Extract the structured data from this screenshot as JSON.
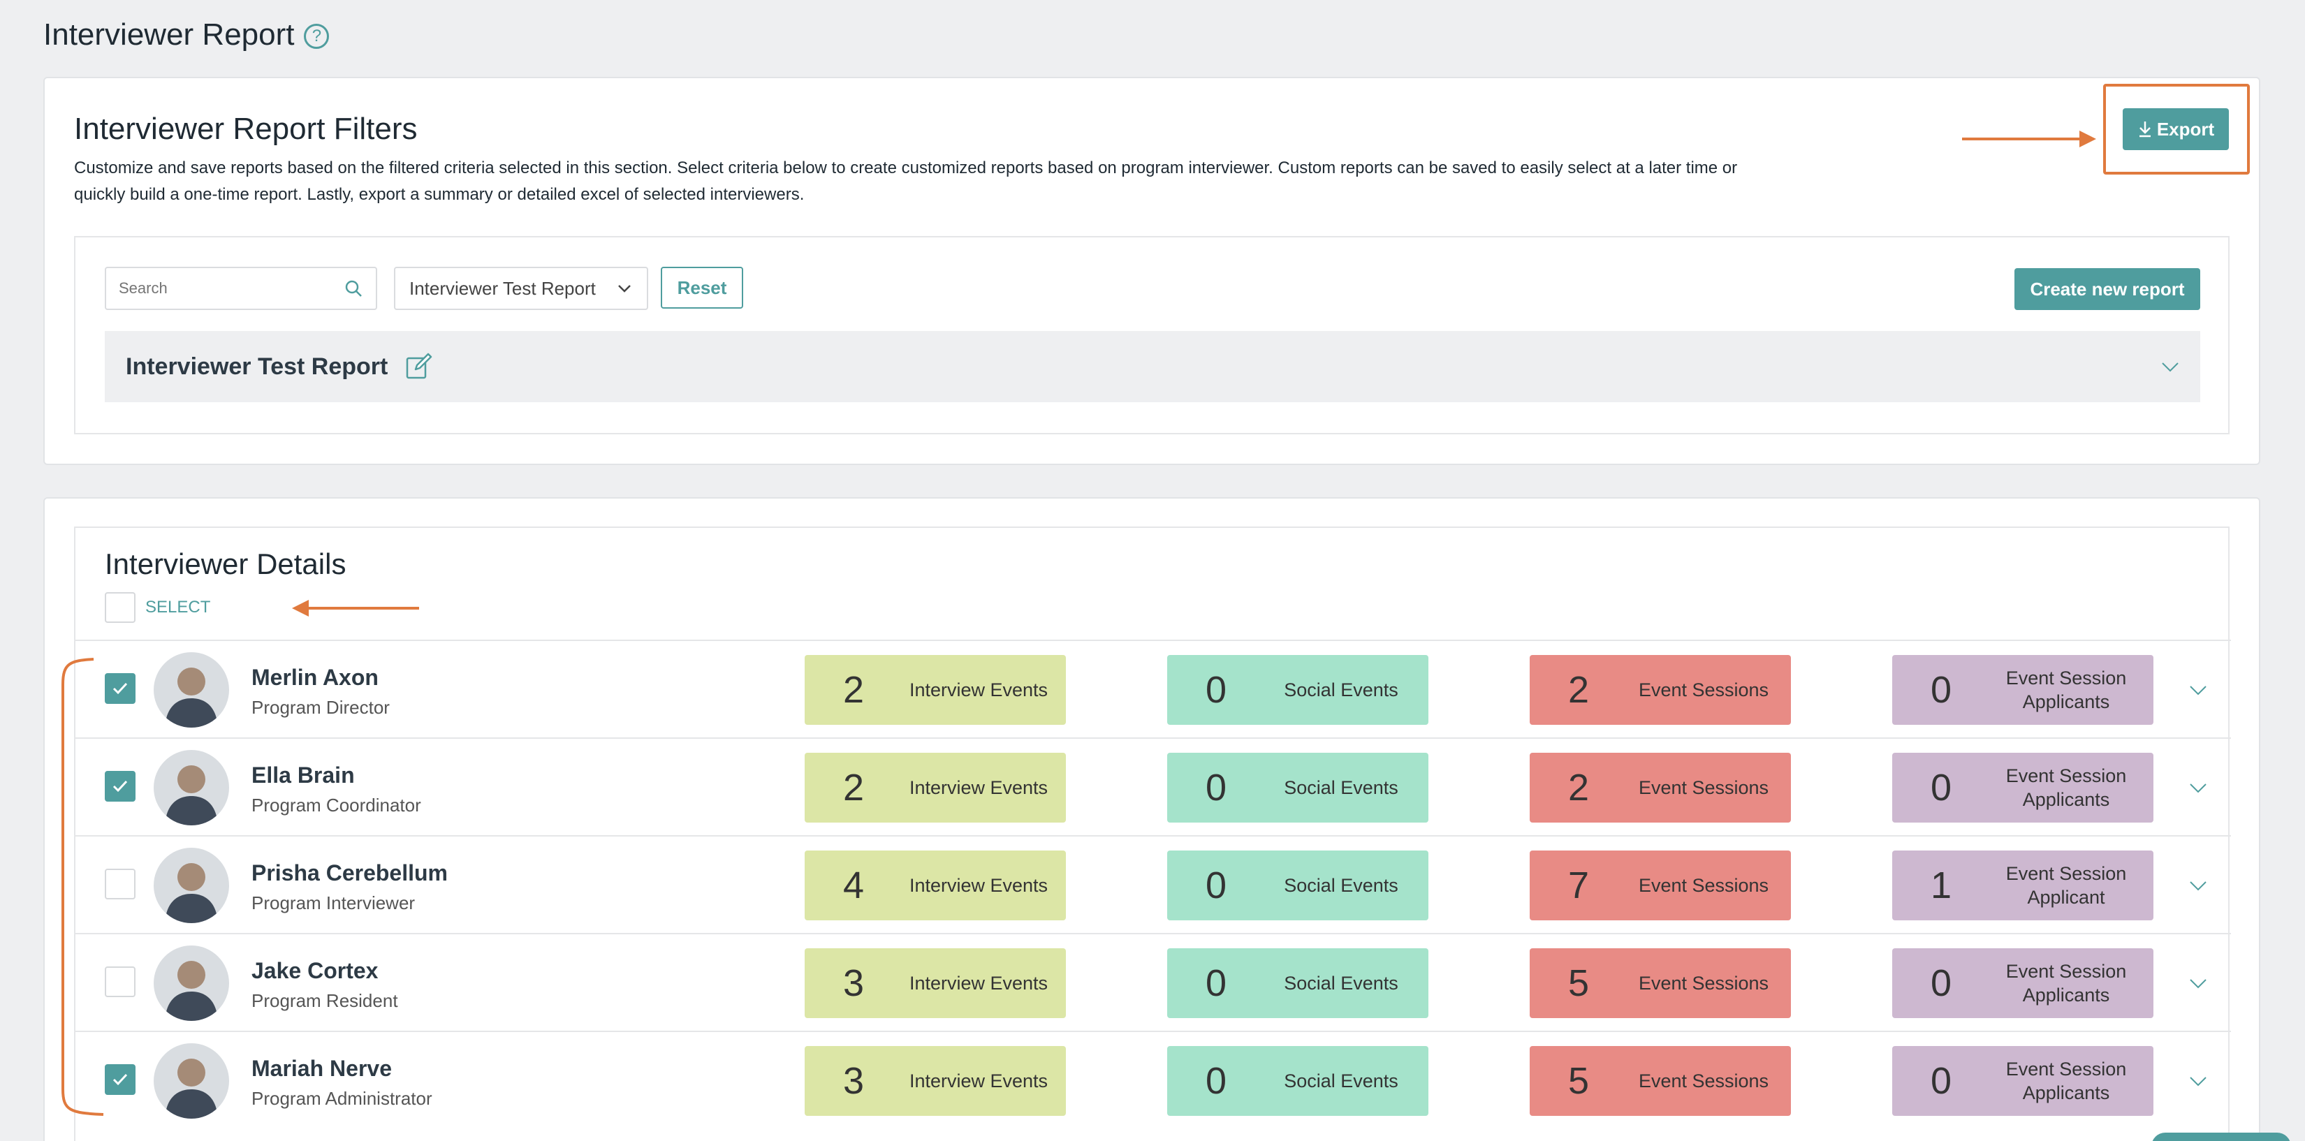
{
  "page": {
    "title": "Interviewer Report"
  },
  "filters": {
    "title": "Interviewer Report Filters",
    "description": "Customize and save reports based on the filtered criteria selected in this section. Select criteria below to create customized reports based on program interviewer. Custom reports can be saved to easily select at a later time or quickly build a one-time report. Lastly, export a summary or detailed excel of selected interviewers.",
    "export_label": "Export",
    "search_placeholder": "Search",
    "selected_report": "Interviewer Test Report",
    "reset_label": "Reset",
    "create_label": "Create new report",
    "report_panel_title": "Interviewer Test Report"
  },
  "details": {
    "title": "Interviewer Details",
    "select_label": "SELECT",
    "rows": [
      {
        "name": "Merlin Axon",
        "role": "Program Director",
        "checked": true,
        "interview_count": "2",
        "interview_label": "Interview Events",
        "social_count": "0",
        "social_label": "Social Events",
        "sessions_count": "2",
        "sessions_label": "Event Sessions",
        "applicants_count": "0",
        "applicants_label_1": "Event Session",
        "applicants_label_2": "Applicants"
      },
      {
        "name": "Ella Brain",
        "role": "Program Coordinator",
        "checked": true,
        "interview_count": "2",
        "interview_label": "Interview Events",
        "social_count": "0",
        "social_label": "Social Events",
        "sessions_count": "2",
        "sessions_label": "Event Sessions",
        "applicants_count": "0",
        "applicants_label_1": "Event Session",
        "applicants_label_2": "Applicants"
      },
      {
        "name": "Prisha Cerebellum",
        "role": "Program Interviewer",
        "checked": false,
        "interview_count": "4",
        "interview_label": "Interview Events",
        "social_count": "0",
        "social_label": "Social Events",
        "sessions_count": "7",
        "sessions_label": "Event Sessions",
        "applicants_count": "1",
        "applicants_label_1": "Event Session",
        "applicants_label_2": "Applicant"
      },
      {
        "name": "Jake Cortex",
        "role": "Program Resident",
        "checked": false,
        "interview_count": "3",
        "interview_label": "Interview Events",
        "social_count": "0",
        "social_label": "Social Events",
        "sessions_count": "5",
        "sessions_label": "Event Sessions",
        "applicants_count": "0",
        "applicants_label_1": "Event Session",
        "applicants_label_2": "Applicants"
      },
      {
        "name": "Mariah Nerve",
        "role": "Program Administrator",
        "checked": true,
        "interview_count": "3",
        "interview_label": "Interview Events",
        "social_count": "0",
        "social_label": "Social Events",
        "sessions_count": "5",
        "sessions_label": "Event Sessions",
        "applicants_count": "0",
        "applicants_label_1": "Event Session",
        "applicants_label_2": "Applicants"
      }
    ]
  },
  "colors": {
    "accent": "#4f9d9e",
    "annotation": "#e07a3e",
    "interview": "#dce6a6",
    "social": "#a5e3cb",
    "sessions": "#e88b85",
    "applicants": "#cdb8d0"
  },
  "icons": [
    "help-icon",
    "download-icon",
    "search-icon",
    "chevron-down-icon",
    "edit-icon",
    "check-icon",
    "avatar-icon"
  ]
}
